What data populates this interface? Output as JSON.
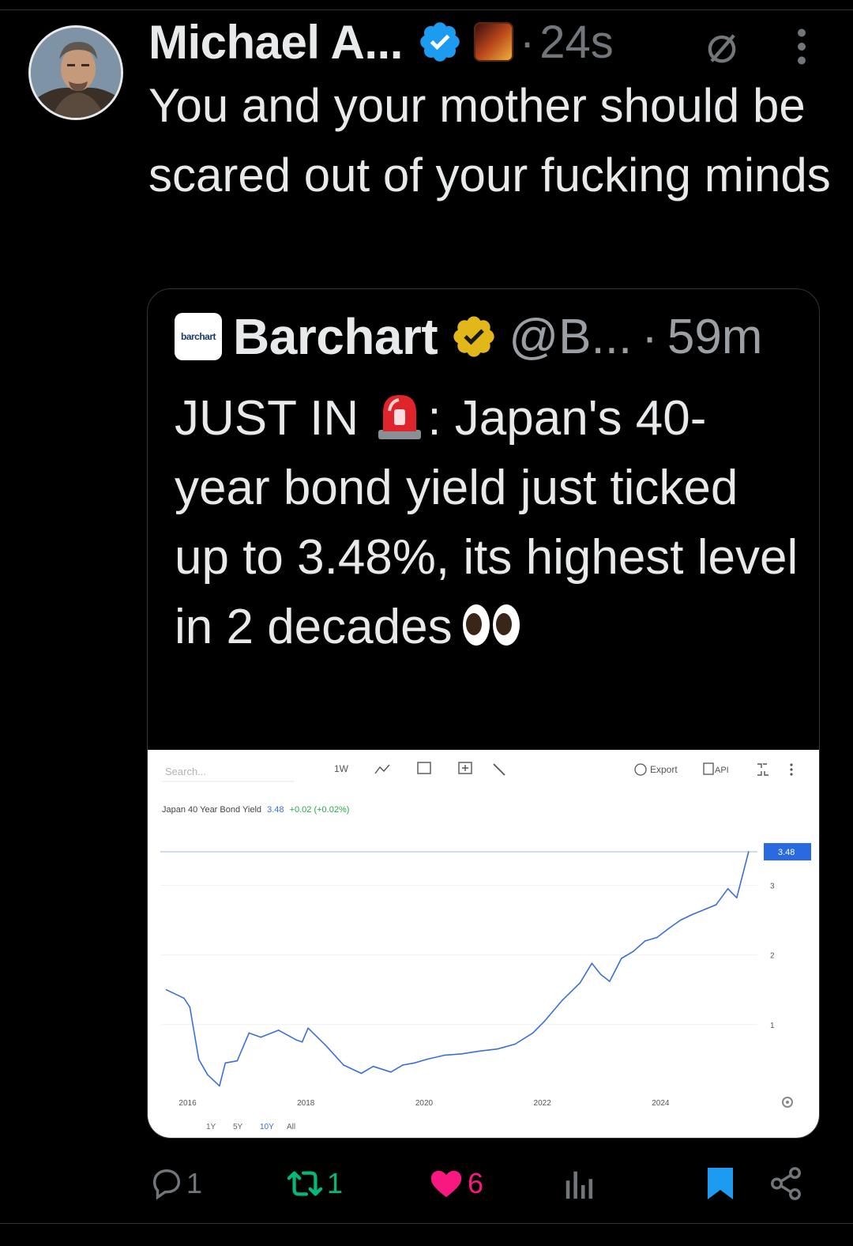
{
  "post": {
    "author_name": "Michael A...",
    "time_sep": "·",
    "time": "24s",
    "text": "You and your mother should be scared out of your fucking minds"
  },
  "quote": {
    "logo_text": "barchart",
    "name": "Barchart",
    "handle": "@B...",
    "time_sep": "·",
    "time": "59m",
    "text_part1": "JUST IN ",
    "text_part2": ": Japan's 40-year bond yield just ticked up to 3.48%, its highest level in 2 decades"
  },
  "chart_ui": {
    "search_placeholder": "Search...",
    "interval": "1W",
    "export_label": "Export",
    "api_label": "API",
    "legend_name": "Japan 40 Year Bond Yield",
    "legend_value": "3.48",
    "legend_change": "+0.02 (+0.02%)",
    "ranges": [
      "1Y",
      "5Y",
      "10Y",
      "All"
    ],
    "active_range": "10Y",
    "price_tag": "3.48"
  },
  "chart_data": {
    "type": "line",
    "series": [
      {
        "name": "Japan 40 Year Bond Yield",
        "x": [
          2015.6,
          2015.9,
          2016.0,
          2016.15,
          2016.3,
          2016.5,
          2016.6,
          2016.8,
          2017.0,
          2017.2,
          2017.5,
          2017.8,
          2017.9,
          2018.0,
          2018.3,
          2018.6,
          2018.9,
          2019.1,
          2019.4,
          2019.6,
          2019.8,
          2020.0,
          2020.3,
          2020.6,
          2020.9,
          2021.2,
          2021.5,
          2021.8,
          2022.0,
          2022.3,
          2022.6,
          2022.8,
          2022.95,
          2023.1,
          2023.3,
          2023.5,
          2023.7,
          2023.9,
          2024.1,
          2024.3,
          2024.5,
          2024.7,
          2024.9,
          2025.1,
          2025.25,
          2025.35,
          2025.45
        ],
        "y": [
          1.5,
          1.38,
          1.25,
          0.5,
          0.28,
          0.12,
          0.45,
          0.48,
          0.88,
          0.82,
          0.92,
          0.78,
          0.75,
          0.95,
          0.7,
          0.42,
          0.3,
          0.4,
          0.32,
          0.42,
          0.45,
          0.5,
          0.56,
          0.58,
          0.62,
          0.65,
          0.72,
          0.88,
          1.05,
          1.35,
          1.6,
          1.88,
          1.72,
          1.62,
          1.95,
          2.05,
          2.2,
          2.25,
          2.38,
          2.5,
          2.58,
          2.65,
          2.72,
          2.95,
          2.82,
          3.15,
          3.48
        ]
      }
    ],
    "x_ticks": [
      "2016",
      "2018",
      "2020",
      "2022",
      "2024"
    ],
    "y_ticks": [
      "1",
      "2",
      "3"
    ],
    "xlim": [
      2015.5,
      2025.6
    ],
    "ylim": [
      0,
      3.9
    ],
    "last_value": 3.48,
    "color": "#3b6fd8"
  },
  "engagement": {
    "replies": "1",
    "reposts": "1",
    "likes": "6"
  },
  "colors": {
    "verified_blue": "#1d9bf0",
    "verified_gold": "#e2b719",
    "repost_green": "#00ba7c",
    "like_pink": "#f91880",
    "bookmark_blue": "#1d9bf0",
    "muted": "#71767b"
  }
}
